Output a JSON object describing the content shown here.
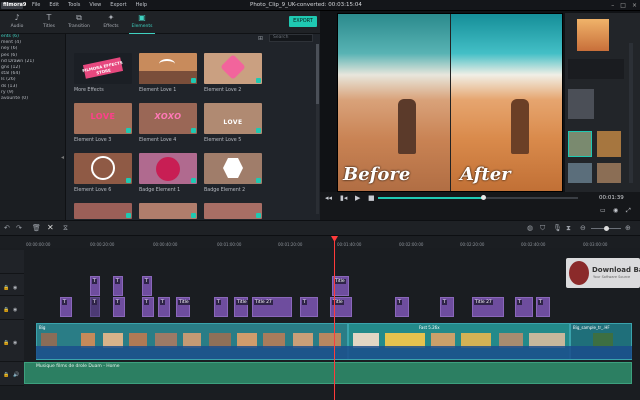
{
  "menubar": {
    "logo": "filmora9",
    "items": [
      "File",
      "Edit",
      "Tools",
      "View",
      "Export",
      "Help"
    ],
    "title": "Photo_Clip_9_UK-converted:  00:03:15:04"
  },
  "toolbar": {
    "tabs": [
      {
        "label": "Audio",
        "icon": "music-note-icon"
      },
      {
        "label": "Titles",
        "icon": "text-t-icon"
      },
      {
        "label": "Transition",
        "icon": "transition-icon"
      },
      {
        "label": "Effects",
        "icon": "effects-icon"
      },
      {
        "label": "Elements",
        "icon": "elements-icon"
      }
    ],
    "export_label": "EXPORT"
  },
  "categories": [
    "ents (6)",
    "ment (4)",
    "ney (6)",
    "pes (6)",
    "nd Drawn (21)",
    "gns (12)",
    "stal (64)",
    "ls (26)",
    "ds (13)",
    "ry (9)",
    "avourite (0)"
  ],
  "search": {
    "placeholder": "Search"
  },
  "library": {
    "items": [
      {
        "label": "More Effects",
        "art": "FILMORA EFFECTS STORE"
      },
      {
        "label": "Element Love 1",
        "art": ""
      },
      {
        "label": "Element Love 2",
        "art": ""
      },
      {
        "label": "Element Love 3",
        "art": "LOVE"
      },
      {
        "label": "Element Love 4",
        "art": "XOXO"
      },
      {
        "label": "Element Love 5",
        "art": "LOVE"
      },
      {
        "label": "Element Love 6",
        "art": ""
      },
      {
        "label": "Badge Element 1",
        "art": ""
      },
      {
        "label": "Badge Element 2",
        "art": ""
      }
    ]
  },
  "preview": {
    "before_text": "Before",
    "after_text": "After",
    "timecode": "00:01:39",
    "progress": 0.53
  },
  "ruler": {
    "ticks": [
      "00:00:00:00",
      "00:00:20:00",
      "00:00:40:00",
      "00:01:00:00",
      "00:01:20:00",
      "00:01:40:00",
      "00:02:00:00",
      "00:02:20:00",
      "00:02:40:00",
      "00:03:00:00"
    ]
  },
  "timeline": {
    "title_clips": [
      "T",
      "T",
      "T",
      "T",
      "T",
      "T",
      "Title",
      "T",
      "T",
      "Title 27",
      "Title",
      "T",
      "Title",
      "T",
      "T",
      "T",
      "Title 27",
      "T",
      "Title",
      "T",
      "T"
    ],
    "video_clips": [
      "Big",
      "Fast 5.26x",
      "Big_sample_tr_.HF"
    ],
    "audio_label": "Musique films de drole Duam - Home"
  },
  "watermark": {
    "title": "Download Ba",
    "subtitle": "Your Software Source"
  },
  "colors": {
    "accent": "#1fc9b2",
    "title_clip": "#6e4d9e",
    "video_clip": "#2a7d86",
    "audio_clip": "#2c7f62",
    "playhead": "#ff3b3b"
  }
}
